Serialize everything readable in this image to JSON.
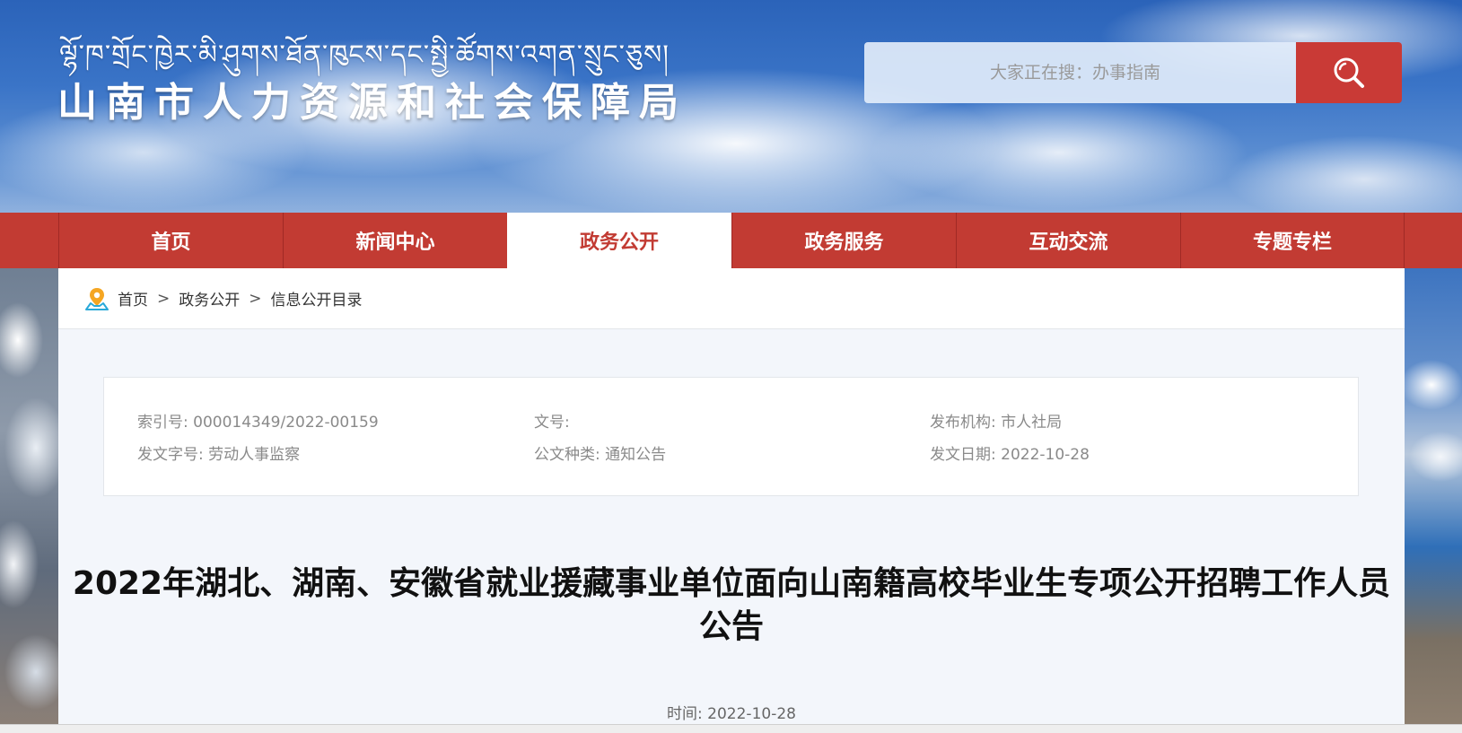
{
  "header": {
    "title_tibetan": "ལྷོ་ཁ་གྲོང་ཁྱེར་མི་ཤུགས་ཐོན་ཁུངས་དང་སྤྱི་ཚོགས་འགན་སྲུང་ཅུས།",
    "title_cn": "山南市人力资源和社会保障局",
    "search": {
      "placeholder": "大家正在搜：办事指南"
    }
  },
  "nav": {
    "items": [
      {
        "label": "首页"
      },
      {
        "label": "新闻中心"
      },
      {
        "label": "政务公开"
      },
      {
        "label": "政务服务"
      },
      {
        "label": "互动交流"
      },
      {
        "label": "专题专栏"
      }
    ],
    "active_index": 2
  },
  "breadcrumb": {
    "items": [
      "首页",
      "政务公开",
      "信息公开目录"
    ],
    "separator": ">"
  },
  "info": {
    "index_label": "索引号:",
    "index_value": "000014349/2022-00159",
    "doc_no_label": "文号:",
    "doc_no_value": "",
    "publisher_label": "发布机构:",
    "publisher_value": "市人社局",
    "issuer_label": "发文字号:",
    "issuer_value": "劳动人事监察",
    "category_label": "公文种类:",
    "category_value": "通知公告",
    "date_label": "发文日期:",
    "date_value": "2022-10-28"
  },
  "article": {
    "title": "2022年湖北、湖南、安徽省就业援藏事业单位面向山南籍高校毕业生专项公开招聘工作人员公告",
    "time_label": "时间:",
    "time_value": "2022-10-28"
  },
  "colors": {
    "nav_red": "#c23b33",
    "search_button": "#c93a36",
    "content_bg": "#f3f6fb"
  }
}
